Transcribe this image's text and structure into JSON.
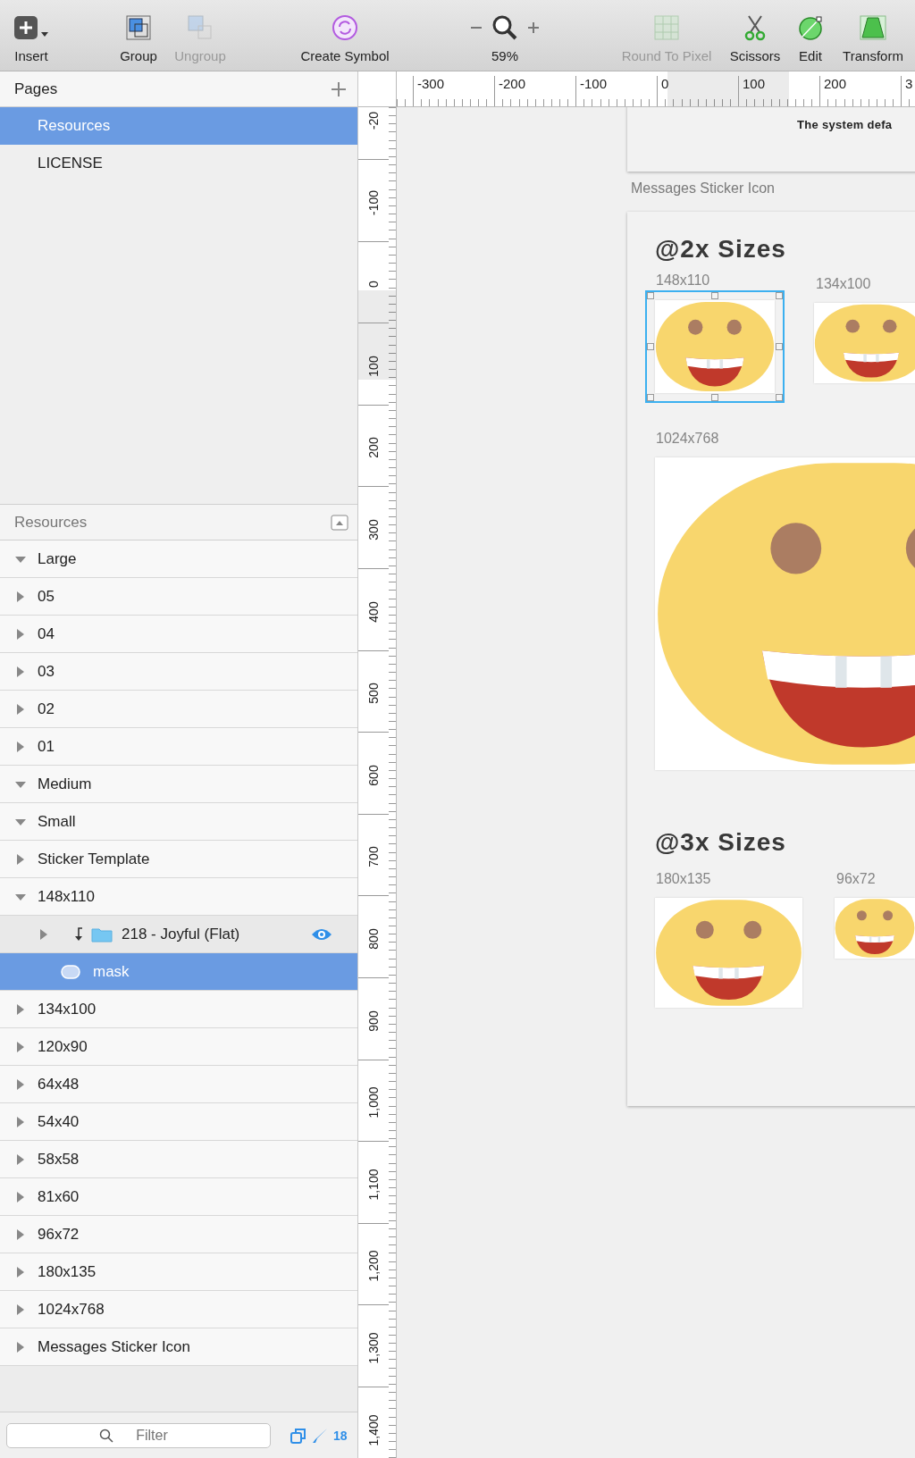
{
  "toolbar": [
    {
      "label": "Insert",
      "kind": "insert",
      "disabled": false
    },
    {
      "label": "Group",
      "kind": "group",
      "disabled": false
    },
    {
      "label": "Ungroup",
      "kind": "ungroup",
      "disabled": true
    },
    {
      "label": "Create Symbol",
      "kind": "symbol",
      "disabled": false
    },
    {
      "label": "59%",
      "kind": "zoom",
      "disabled": false
    },
    {
      "label": "Round To Pixel",
      "kind": "round",
      "disabled": true
    },
    {
      "label": "Scissors",
      "kind": "scissors",
      "disabled": false
    },
    {
      "label": "Edit",
      "kind": "edit",
      "disabled": false
    },
    {
      "label": "Transform",
      "kind": "transform",
      "disabled": false
    }
  ],
  "pages": {
    "title": "Pages",
    "items": [
      {
        "name": "Resources",
        "selected": true
      },
      {
        "name": "LICENSE",
        "selected": false
      }
    ]
  },
  "layers": {
    "title": "Resources",
    "items": [
      {
        "name": "Large",
        "kind": "group",
        "expanded": true,
        "selected": false
      },
      {
        "name": "05",
        "kind": "group",
        "expanded": false,
        "selected": false
      },
      {
        "name": "04",
        "kind": "group",
        "expanded": false,
        "selected": false
      },
      {
        "name": "03",
        "kind": "group",
        "expanded": false,
        "selected": false
      },
      {
        "name": "02",
        "kind": "group",
        "expanded": false,
        "selected": false
      },
      {
        "name": "01",
        "kind": "group",
        "expanded": false,
        "selected": false
      },
      {
        "name": "Medium",
        "kind": "group",
        "expanded": true,
        "selected": false
      },
      {
        "name": "Small",
        "kind": "group",
        "expanded": true,
        "selected": false
      },
      {
        "name": "Sticker Template",
        "kind": "group",
        "expanded": false,
        "selected": false
      },
      {
        "name": "148x110",
        "kind": "group",
        "expanded": true,
        "selected": false,
        "children": [
          {
            "name": "218 - Joyful (Flat)",
            "kind": "masked-folder",
            "expanded": false,
            "selected": false,
            "hovered": true
          },
          {
            "name": "mask",
            "kind": "mask-shape",
            "selected": true
          }
        ]
      },
      {
        "name": "134x100",
        "kind": "group",
        "expanded": false,
        "selected": false
      },
      {
        "name": "120x90",
        "kind": "group",
        "expanded": false,
        "selected": false
      },
      {
        "name": "64x48",
        "kind": "group",
        "expanded": false,
        "selected": false
      },
      {
        "name": "54x40",
        "kind": "group",
        "expanded": false,
        "selected": false
      },
      {
        "name": "58x58",
        "kind": "group",
        "expanded": false,
        "selected": false
      },
      {
        "name": "81x60",
        "kind": "group",
        "expanded": false,
        "selected": false
      },
      {
        "name": "96x72",
        "kind": "group",
        "expanded": false,
        "selected": false
      },
      {
        "name": "180x135",
        "kind": "group",
        "expanded": false,
        "selected": false
      },
      {
        "name": "1024x768",
        "kind": "group",
        "expanded": false,
        "selected": false
      },
      {
        "name": "Messages Sticker Icon",
        "kind": "group",
        "expanded": false,
        "selected": false
      }
    ]
  },
  "footer": {
    "placeholder": "Filter",
    "count": "18"
  },
  "rulers": {
    "horizontal": [
      "-300",
      "-200",
      "-100",
      "0",
      "100",
      "200",
      "3"
    ],
    "vertical": [
      "-20",
      "-100",
      "0",
      "100",
      "200",
      "300",
      "400",
      "500",
      "600",
      "700",
      "800",
      "900",
      "1,000",
      "1,100",
      "1,200",
      "1,300",
      "1,400"
    ]
  },
  "canvas": {
    "top_artboard_text": "The system defa",
    "artboard_title": "Messages Sticker Icon",
    "sections": [
      {
        "heading": "@2x Sizes",
        "stickers": [
          {
            "label": "148x110",
            "selected": true
          },
          {
            "label": "134x100",
            "selected": false
          },
          {
            "label": "1024x768",
            "selected": false
          }
        ]
      },
      {
        "heading": "@3x Sizes",
        "stickers": [
          {
            "label": "180x135",
            "selected": false
          },
          {
            "label": "96x72",
            "selected": false
          }
        ]
      }
    ]
  }
}
